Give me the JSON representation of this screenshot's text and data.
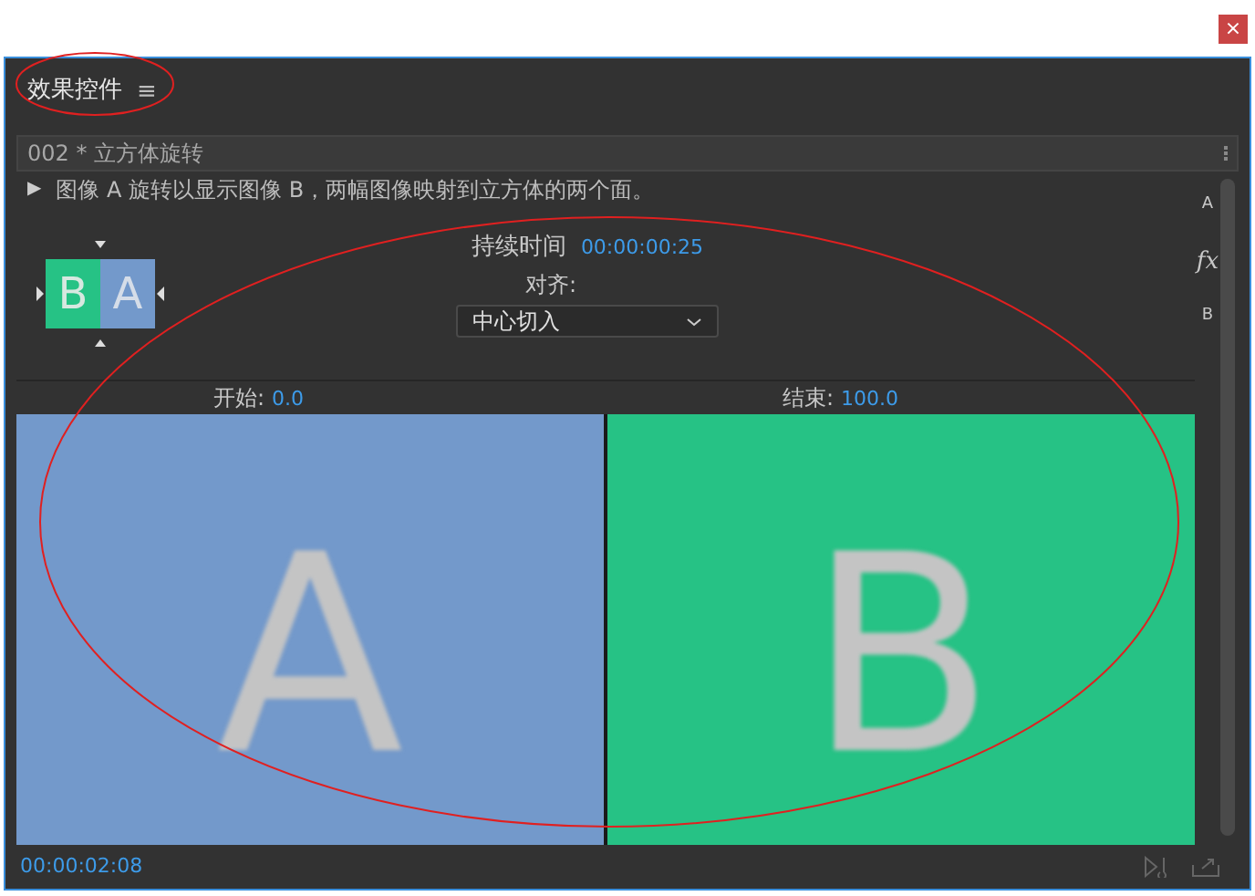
{
  "window": {
    "close": "×"
  },
  "panel": {
    "title": "效果控件",
    "menu": "≡"
  },
  "effect": {
    "header": "002 * 立方体旋转",
    "expand": "▶",
    "description": "图像 A 旋转以显示图像 B，两幅图像映射到立方体的两个面。",
    "thumbnail": {
      "left": "B",
      "right": "A"
    },
    "duration_label": "持续时间",
    "duration": "00:00:00:25",
    "align_label": "对齐:",
    "align_value": "中心切入",
    "side_labels": [
      "A",
      "fx",
      "B"
    ],
    "start_label": "开始:",
    "start": "0.0",
    "end_label": "结束:",
    "end": "100.0",
    "preview": [
      {
        "letter": "A",
        "color": "#7399cb"
      },
      {
        "letter": "B",
        "color": "#26c285"
      }
    ]
  },
  "status_bar": {
    "timecode": "00:00:02:08"
  }
}
